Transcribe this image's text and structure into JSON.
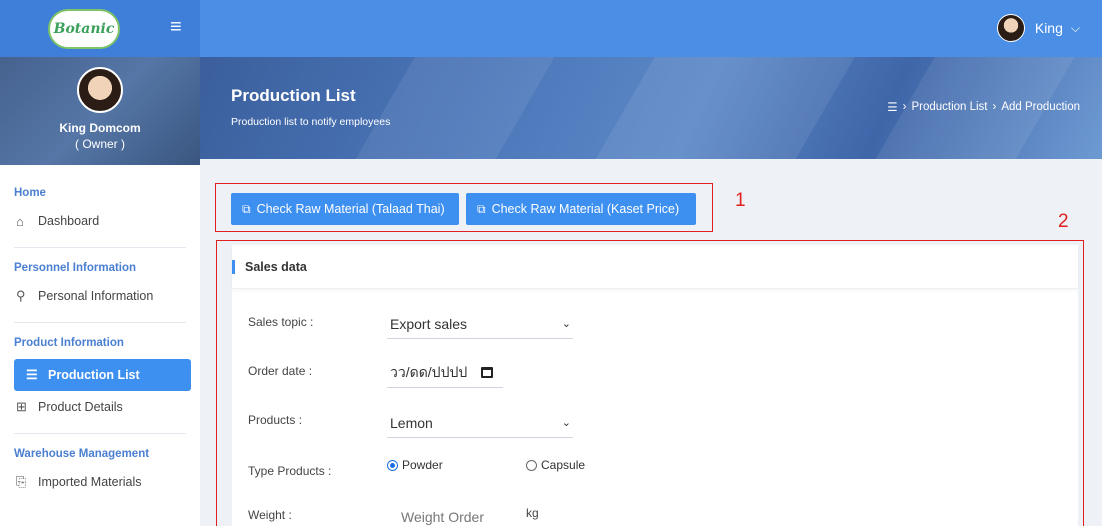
{
  "header": {
    "user_name": "King",
    "logo_text": "Botanic"
  },
  "sidebar": {
    "profile": {
      "name": "King Domcom",
      "role": "( Owner )"
    },
    "sections": [
      {
        "heading": "Home",
        "items": [
          {
            "label": "Dashboard",
            "icon": "home-icon"
          }
        ]
      },
      {
        "heading": "Personnel Information",
        "items": [
          {
            "label": "Personal Information",
            "icon": "user-icon"
          }
        ]
      },
      {
        "heading": "Product Information",
        "items": [
          {
            "label": "Production List",
            "icon": "list-icon",
            "active": true
          },
          {
            "label": "Product Details",
            "icon": "grid-icon"
          }
        ]
      },
      {
        "heading": "Warehouse Management",
        "items": [
          {
            "label": "Imported Materials",
            "icon": "import-icon"
          }
        ]
      }
    ]
  },
  "banner": {
    "title": "Production List",
    "subtitle": "Production list to notify employees",
    "breadcrumb": [
      "Production List",
      "Add Production"
    ]
  },
  "actions": {
    "btn1": "Check Raw Material (Talaad Thai)",
    "btn2": "Check Raw Material (Kaset Price)"
  },
  "annotations": {
    "a1": "1",
    "a2": "2"
  },
  "form": {
    "card_title": "Sales data",
    "sales_topic_label": "Sales topic :",
    "sales_topic_value": "Export sales",
    "order_date_label": "Order date :",
    "order_date_value": "วว/ดด/ปปปป",
    "products_label": "Products :",
    "products_value": "Lemon",
    "type_label": "Type Products :",
    "type_options": [
      "Powder",
      "Capsule"
    ],
    "type_selected": "Powder",
    "weight_label": "Weight :",
    "weight_placeholder": "Weight Order",
    "weight_unit": "kg"
  },
  "colors": {
    "primary": "#3d8ff0",
    "topbar": "#4a8ee6",
    "annotation": "#e02020"
  }
}
